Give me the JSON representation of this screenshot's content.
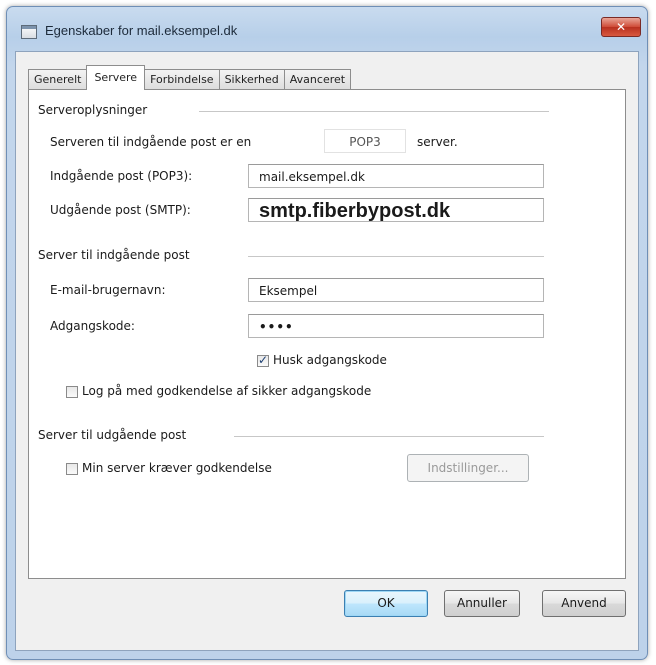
{
  "window": {
    "title": "Egenskaber for mail.eksempel.dk",
    "close_label": "✕"
  },
  "tabs": [
    {
      "label": "Generelt"
    },
    {
      "label": "Servere",
      "active": true
    },
    {
      "label": "Forbindelse"
    },
    {
      "label": "Sikkerhed"
    },
    {
      "label": "Avanceret"
    }
  ],
  "server_info": {
    "section_title": "Serveroplysninger",
    "incoming_type_prefix": "Serveren til indgående post er en",
    "incoming_type_value": "POP3",
    "incoming_type_suffix": "server.",
    "incoming_label": "Indgående post (POP3):",
    "incoming_value": "mail.eksempel.dk",
    "outgoing_label": "Udgående post (SMTP):",
    "outgoing_value": "smtp.fiberbypost.dk"
  },
  "incoming_server": {
    "section_title": "Server til indgående post",
    "username_label": "E-mail-brugernavn:",
    "username_value": "Eksempel",
    "password_label": "Adgangskode:",
    "password_value": "••••",
    "remember_label": "Husk adgangskode",
    "remember_checked": true,
    "secure_auth_label": "Log på med godkendelse af sikker adgangskode",
    "secure_auth_checked": false
  },
  "outgoing_server": {
    "section_title": "Server til udgående post",
    "requires_auth_label": "Min server kræver godkendelse",
    "requires_auth_checked": false,
    "settings_button": "Indstillinger..."
  },
  "footer": {
    "ok": "OK",
    "cancel": "Annuller",
    "apply": "Anvend"
  }
}
